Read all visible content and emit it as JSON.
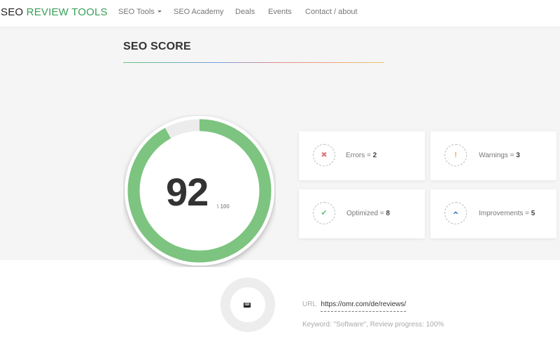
{
  "brand": {
    "part1": "SEO",
    "part2": "REVIEW TOOLS",
    "accent_color": "#3aa05a"
  },
  "nav": {
    "items": [
      {
        "label": "SEO Tools",
        "has_dropdown": true,
        "icon": "caret-down-icon"
      },
      {
        "label": "SEO Academy"
      },
      {
        "label": "Deals"
      },
      {
        "label": "Events"
      },
      {
        "label": "Contact / about"
      }
    ]
  },
  "score": {
    "title": "SEO SCORE",
    "value": "92",
    "max_label": "\\ 100",
    "fraction": 0.92,
    "ring_color": "#7cc47f"
  },
  "stats": [
    {
      "label": "Errors = ",
      "count": "2",
      "icon": "close-icon",
      "glyph": "✖",
      "color": "#e07a7a"
    },
    {
      "label": "Warnings = ",
      "count": "3",
      "icon": "exclamation-icon",
      "glyph": "!",
      "color": "#f0ad4e"
    },
    {
      "label": "Optimized = ",
      "count": "8",
      "icon": "check-icon",
      "glyph": "✔",
      "color": "#69c27d"
    },
    {
      "label": "Improvements = ",
      "count": "5",
      "icon": "chevron-up-icon",
      "glyph": "⌃",
      "color": "#3b6fb6"
    }
  ],
  "review": {
    "url_label": "URL",
    "url_value": "https://omr.com/de/reviews/",
    "keyword_text": "Keyword: \"Software\", Review progress: 100%",
    "icon": "keyboard-icon"
  }
}
